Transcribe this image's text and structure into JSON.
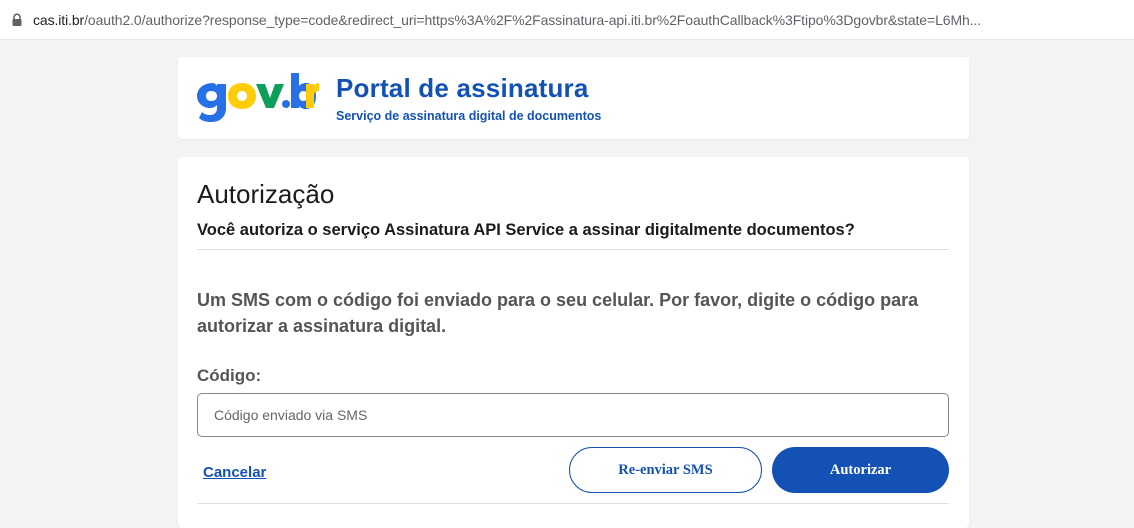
{
  "browser": {
    "url_host": "cas.iti.br",
    "url_rest": "/oauth2.0/authorize?response_type=code&redirect_uri=https%3A%2F%2Fassinatura-api.iti.br%2FoauthCallback%3Ftipo%3Dgovbr&state=L6Mh...",
    "secure_icon": "lock-icon"
  },
  "header": {
    "logo_text": "gov.br",
    "title": "Portal de assinatura",
    "subtitle": "Serviço de assinatura digital de documentos"
  },
  "auth": {
    "title": "Autorização",
    "question": "Você autoriza o serviço Assinatura API Service a assinar digitalmente documentos?",
    "sms_message": "Um SMS com o código foi enviado para o seu celular. Por favor, digite o código para autorizar a assinatura digital.",
    "code_label": "Código:",
    "code_value": "",
    "code_placeholder": "Código enviado via SMS",
    "cancel_label": "Cancelar",
    "resend_label": "Re-enviar SMS",
    "authorize_label": "Autorizar"
  },
  "colors": {
    "primary": "#1351b4",
    "logo_blue": "#2670e8",
    "logo_yellow": "#ffcd07",
    "logo_green": "#0c9f58",
    "text_dark": "#1b1b1b",
    "text_gray": "#555555",
    "background": "#f3f3f3"
  }
}
